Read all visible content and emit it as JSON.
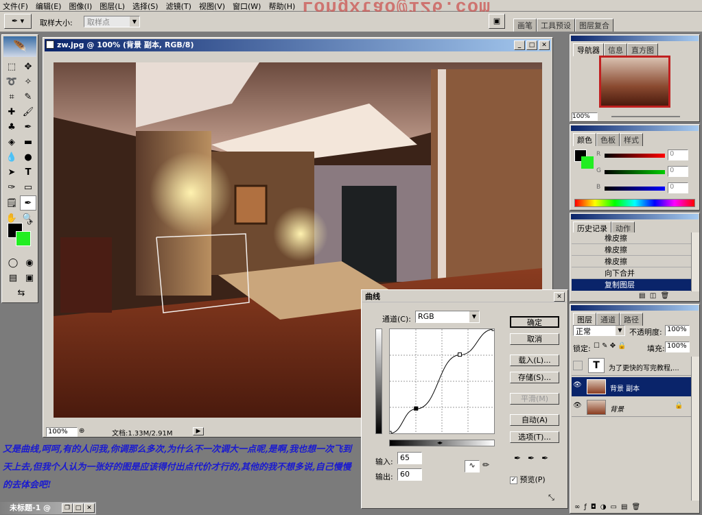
{
  "menu": [
    "文件(F)",
    "编辑(E)",
    "图像(I)",
    "图层(L)",
    "选择(S)",
    "滤镜(T)",
    "视图(V)",
    "窗口(W)",
    "帮助(H)"
  ],
  "watermark": "Longxtao@126.com",
  "options": {
    "sample_size_label": "取样大小:",
    "sample_size_value": "取样点"
  },
  "top_tabs": [
    "画笔",
    "工具预设",
    "图层复合"
  ],
  "document": {
    "title": "zw.jpg @ 100% (背景 副本, RGB/8)",
    "zoom": "100%",
    "doc_size": "文档:1.33M/2.91M"
  },
  "navigator": {
    "tabs": [
      "导航器",
      "信息",
      "直方图"
    ],
    "zoom": "100%"
  },
  "color_panel": {
    "tabs": [
      "颜色",
      "色板",
      "样式"
    ],
    "channels": [
      {
        "name": "R",
        "value": "0"
      },
      {
        "name": "G",
        "value": "0"
      },
      {
        "name": "B",
        "value": "0"
      }
    ]
  },
  "history": {
    "tabs": [
      "历史记录",
      "动作"
    ],
    "items": [
      "橡皮擦",
      "橡皮擦",
      "橡皮擦",
      "向下合并",
      "复制图层"
    ],
    "selected_index": 4
  },
  "layers": {
    "tabs": [
      "图层",
      "通道",
      "路径"
    ],
    "blend_mode": "正常",
    "opacity_label": "不透明度:",
    "opacity": "100%",
    "lock_label": "锁定:",
    "fill_label": "填充:",
    "fill": "100%",
    "items": [
      {
        "name": "为了更快的写完教程,...",
        "type": "text",
        "icon": "T"
      },
      {
        "name": "背景 副本",
        "type": "image",
        "selected": true
      },
      {
        "name": "背景",
        "type": "image",
        "locked": true
      }
    ]
  },
  "curves": {
    "title": "曲线",
    "channel_label": "通道(C):",
    "channel": "RGB",
    "buttons": [
      "确定",
      "取消",
      "载入(L)...",
      "存储(S)...",
      "平滑(M)",
      "自动(A)",
      "选项(T)..."
    ],
    "input_label": "输入:",
    "input": "65",
    "output_label": "输出:",
    "output": "60",
    "preview_label": "预览(P)",
    "points": [
      [
        0,
        0
      ],
      [
        65,
        60
      ],
      [
        172,
        192
      ],
      [
        255,
        255
      ]
    ]
  },
  "caption": "又是曲线,呵呵,有的人问我,你调那么多次,为什么不一次调大一点呢,是啊,我也想一次飞到天上去,但我个人认为一张好的图是应该得付出点代价才行的,其他的我不想多说,自己慢慢的去体会吧!",
  "taskbar": {
    "window_title": "未标题-1 @"
  },
  "colors": {
    "accent": "#0a246a",
    "caption_blue": "#1a1ad0",
    "fg_swatch": "#000000",
    "bg_swatch": "#22ee22"
  }
}
